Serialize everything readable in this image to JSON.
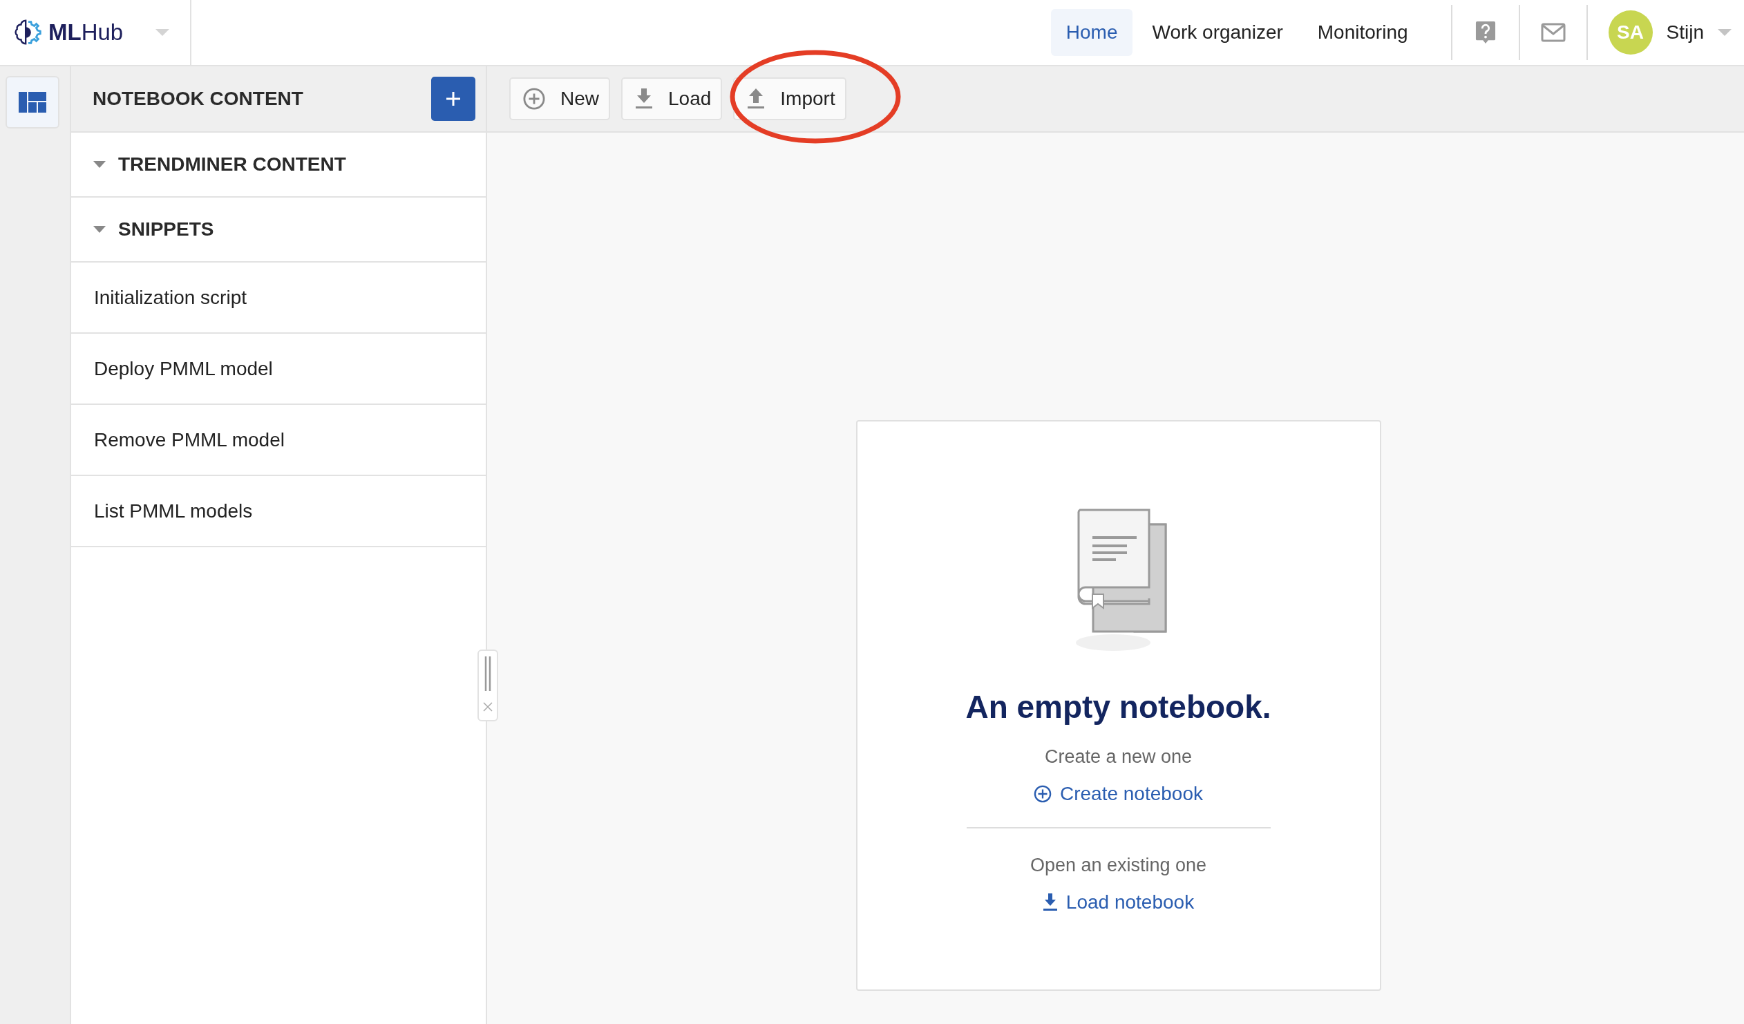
{
  "logo": {
    "text": "**ML**Hub"
  },
  "nav": [
    {
      "label": "Home",
      "selected": true
    },
    {
      "label": "Work organizer",
      "selected": false
    },
    {
      "label": "Monitoring",
      "selected": false
    }
  ],
  "user": {
    "initials": "SA",
    "name": "Stijn"
  },
  "sidebar": {
    "title": "NOTEBOOK CONTENT",
    "sections": [
      {
        "label": "TRENDMINER CONTENT",
        "expanded": true
      },
      {
        "label": "SNIPPETS",
        "expanded": true,
        "items": [
          "Initialization script",
          "Deploy PMML model",
          "Remove PMML model",
          "List PMML models"
        ]
      }
    ]
  },
  "toolbar": [
    {
      "label": "New",
      "kind": "new"
    },
    {
      "label": "Load",
      "kind": "load"
    },
    {
      "label": "Import",
      "kind": "import"
    }
  ],
  "empty_state": {
    "title": "An empty notebook.",
    "create_hint": "Create a new one",
    "create_link": "Create notebook",
    "open_hint": "Open an existing one",
    "load_link": "Load notebook"
  }
}
